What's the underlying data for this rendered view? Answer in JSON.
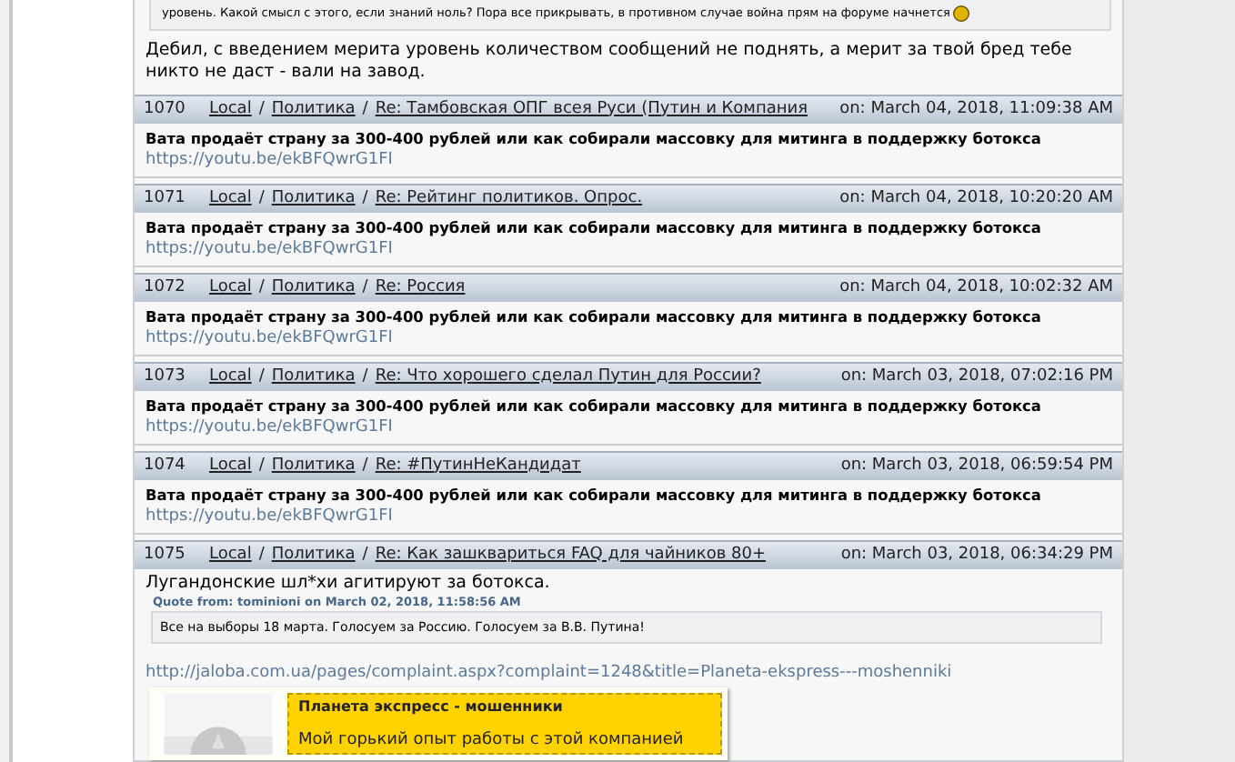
{
  "top_post": {
    "quote_text": "уровень. Какой смысл с этого, если знаний ноль? Пора все прикрывать, в противном случае война прям на форуме начнется",
    "body": "Дебил, с введением мерита уровень количеством сообщений не поднять, а мерит за твой бред тебе никто не даст - вали на завод."
  },
  "posts": [
    {
      "kind": "link",
      "number": "1070",
      "board": "Local",
      "separator": "/",
      "category": "Политика",
      "topic": "Re: Тамбовская ОПГ всея Руси (Путин и Компания",
      "date": "on: March 04, 2018, 11:09:38 AM",
      "title": "Вата продаёт страну за 300-400 рублей или как собирали массовку для митинга в поддержку ботокса",
      "link": "https://youtu.be/ekBFQwrG1FI"
    },
    {
      "kind": "link",
      "number": "1071",
      "board": "Local",
      "separator": "/",
      "category": "Политика",
      "topic": "Re: Рейтинг политиков. Опрос.",
      "date": "on: March 04, 2018, 10:20:20 AM",
      "title": "Вата продаёт страну за 300-400 рублей или как собирали массовку для митинга в поддержку ботокса",
      "link": "https://youtu.be/ekBFQwrG1FI"
    },
    {
      "kind": "link",
      "number": "1072",
      "board": "Local",
      "separator": "/",
      "category": "Политика",
      "topic": "Re: Россия",
      "date": "on: March 04, 2018, 10:02:32 AM",
      "title": "Вата продаёт страну за 300-400 рублей или как собирали массовку для митинга в поддержку ботокса",
      "link": "https://youtu.be/ekBFQwrG1FI"
    },
    {
      "kind": "link",
      "number": "1073",
      "board": "Local",
      "separator": "/",
      "category": "Политика",
      "topic": "Re: Что хорошего сделал Путин для России?",
      "date": "on: March 03, 2018, 07:02:16 PM",
      "title": "Вата продаёт страну за 300-400 рублей или как собирали массовку для митинга в поддержку ботокса",
      "link": "https://youtu.be/ekBFQwrG1FI"
    },
    {
      "kind": "link",
      "number": "1074",
      "board": "Local",
      "separator": "/",
      "category": "Политика",
      "topic": "Re: #ПутинНеКандидат",
      "date": "on: March 03, 2018, 06:59:54 PM",
      "title": "Вата продаёт страну за 300-400 рублей или как собирали массовку для митинга в поддержку ботокса",
      "link": "https://youtu.be/ekBFQwrG1FI"
    },
    {
      "kind": "quote",
      "number": "1075",
      "board": "Local",
      "separator": "/",
      "category": "Политика",
      "topic": "Re: Как зашквариться FAQ для чайников 80+",
      "date": "on: March 03, 2018, 06:34:29 PM",
      "body": "Лугандонские шл*хи агитируют за ботокса.",
      "quote_header": "Quote from: tominioni on March 02, 2018, 11:58:56 AM",
      "quote_text": "Все на выборы 18 марта. Голосуем за Россию. Голосуем за В.В. Путина!",
      "link": "http://jaloba.com.ua/pages/complaint.aspx?complaint=1248&title=Planeta-ekspress---moshenniki",
      "preview": {
        "title": "Планета экспресс - мошенники",
        "text": "Мой горький опыт работы с этой компанией"
      }
    }
  ]
}
